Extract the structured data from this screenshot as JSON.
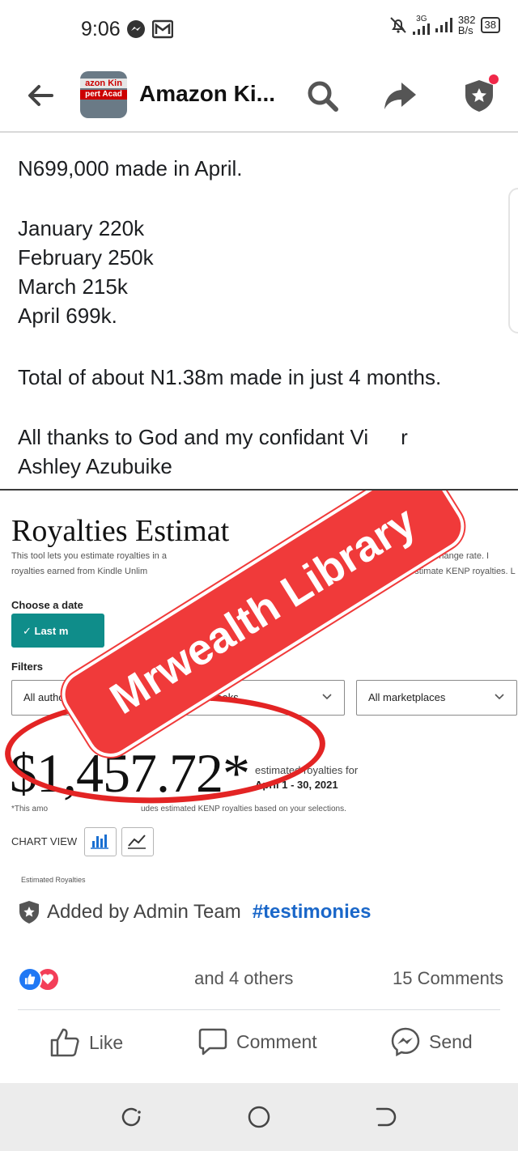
{
  "status_bar": {
    "time": "9:06",
    "network_label": "3G",
    "speed_value": "382",
    "speed_unit": "B/s",
    "battery": "38"
  },
  "app_bar": {
    "group_name": "Amazon Ki...",
    "thumb_line1": "azon Kin",
    "thumb_line2": "pert Acad",
    "notification_dot_color": "#f02849"
  },
  "post": {
    "lines": {
      "headline": "N699,000 made in April.",
      "january": "January 220k",
      "february": "February 250k",
      "march": "March 215k",
      "april": "April 699k.",
      "total": "Total of about N1.38m made in just 4 months.",
      "thanks_1": "All thanks to God and my confidant Vi",
      "thanks_1_end": "r",
      "thanks_2": "Ashley Azubuike"
    }
  },
  "image": {
    "title": "Royalties Estimat",
    "desc_line1": "This tool lets you estimate royalties in a",
    "desc_line1_end": "ed on the current exchange rate. I",
    "desc_line2": "royalties earned from Kindle Unlim",
    "desc_line2_end": "NP Rates to estimate KENP royalties.  L",
    "choose_date_label": "Choose a date",
    "date_button": "✓ Last m",
    "filters_label": "Filters",
    "filter_authors": "All author",
    "filter_books": "All books",
    "filter_marketplaces": "All marketplaces",
    "amount": "$1,457.72*",
    "estimated_line1": "estimated royalties for",
    "estimated_line2": "April 1 - 30, 2021",
    "footnote_start": "*This amo",
    "footnote_end": "udes estimated KENP royalties based on your selections.",
    "chart_view_label": "CHART VIEW",
    "estimated_royalties_small": "Estimated Royalties",
    "watermark": "Mrwealth Library",
    "accent_color": "#0f8d8a",
    "highlight_color": "#e32424"
  },
  "meta": {
    "added_by": "Added by Admin Team",
    "hashtag": "#testimonies",
    "reactions_text": "and 4 others",
    "comments_count": "15 Comments"
  },
  "actions": {
    "like": "Like",
    "comment": "Comment",
    "send": "Send"
  },
  "icons": {
    "back": "arrow-left-icon",
    "search": "search-icon",
    "share": "share-arrow-icon",
    "admin": "shield-star-icon",
    "like": "thumbs-up-icon",
    "comment": "speech-bubble-icon",
    "send": "messenger-icon"
  }
}
